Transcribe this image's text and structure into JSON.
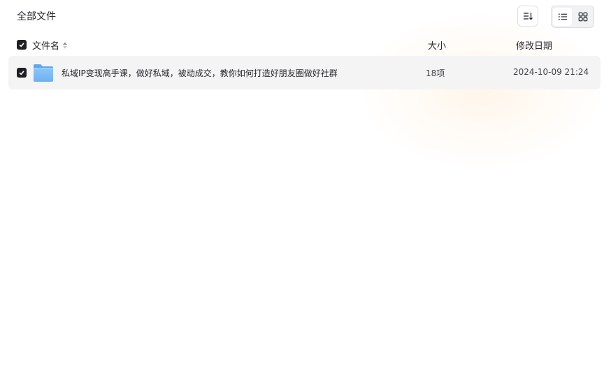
{
  "breadcrumb": {
    "title": "全部文件"
  },
  "toolbar": {
    "sort_icon": "sort-list-icon",
    "view_list_icon": "list-view-icon",
    "view_grid_icon": "grid-view-icon",
    "active_view": "list"
  },
  "table": {
    "columns": {
      "name": "文件名",
      "size": "大小",
      "modified": "修改日期"
    },
    "select_all_checked": true,
    "rows": [
      {
        "type": "folder",
        "checked": true,
        "name": "私域IP变现高手课，做好私域，被动成交，教你如何打造好朋友圈做好社群",
        "size": "18项",
        "modified": "2024-10-09 21:24"
      }
    ]
  },
  "colors": {
    "checkbox": "#1f1f23",
    "row_highlight": "#f4f4f5",
    "folder": "#7ab8f5",
    "border": "#dcdee3"
  }
}
